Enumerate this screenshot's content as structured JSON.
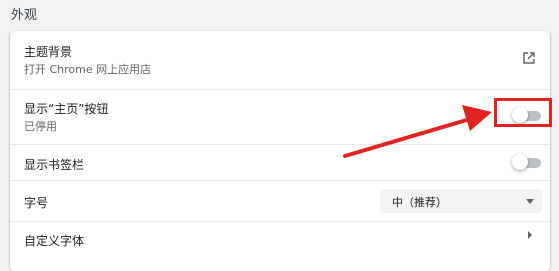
{
  "section": {
    "title": "外观"
  },
  "settings": {
    "theme": {
      "label": "主题背景",
      "sub": "打开 Chrome 网上应用店"
    },
    "home_button": {
      "label": "显示“主页”按钮",
      "sub": "已停用",
      "enabled": false
    },
    "bookmarks_bar": {
      "label": "显示书签栏",
      "enabled": false
    },
    "font_size": {
      "label": "字号",
      "selected": "中（推荐）"
    },
    "custom_fonts": {
      "label": "自定义字体"
    }
  },
  "annotation": {
    "color": "#e32222"
  },
  "icons": [
    "open-in-new-icon",
    "chevron-down-icon",
    "chevron-right-icon"
  ]
}
